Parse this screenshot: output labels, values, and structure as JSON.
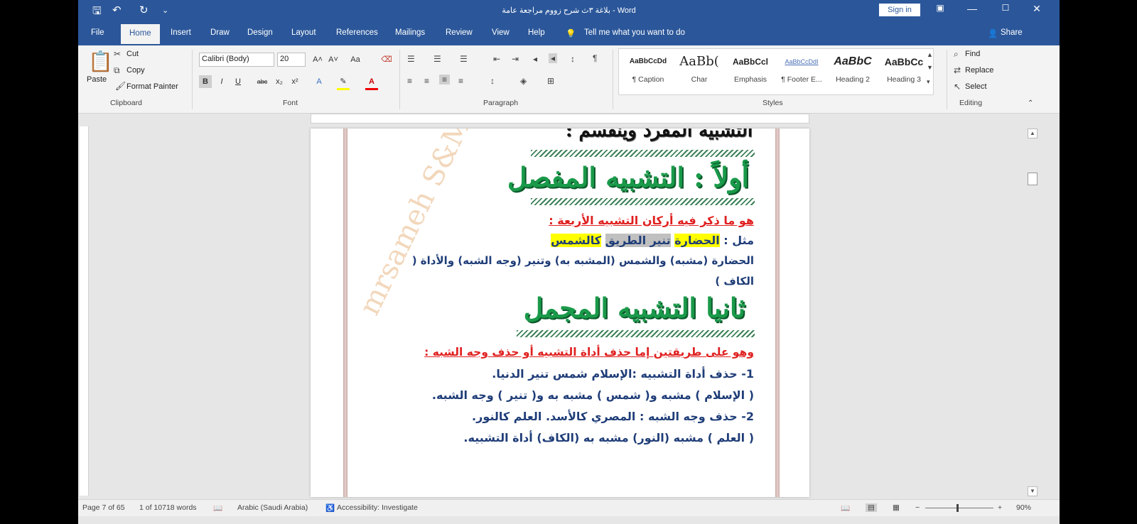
{
  "window": {
    "title": "بلاغة ٣ث شرح زووم مراجعة عامة - Word",
    "sign_in": "Sign in",
    "restore_icon": "ribbon-display-icon",
    "min_symbol": "—",
    "max_symbol": "☐",
    "close_symbol": "✕"
  },
  "quick_access": {
    "save": "🖫",
    "undo": "↶",
    "redo": "↻",
    "more": "⌄"
  },
  "tabs": [
    {
      "label": "File"
    },
    {
      "label": "Home"
    },
    {
      "label": "Insert"
    },
    {
      "label": "Draw"
    },
    {
      "label": "Design"
    },
    {
      "label": "Layout"
    },
    {
      "label": "References"
    },
    {
      "label": "Mailings"
    },
    {
      "label": "Review"
    },
    {
      "label": "View"
    },
    {
      "label": "Help"
    }
  ],
  "tell_me": "Tell me what you want to do",
  "share": "Share",
  "clipboard": {
    "paste": "Paste",
    "cut": "Cut",
    "copy": "Copy",
    "format_painter": "Format Painter",
    "label": "Clipboard"
  },
  "font": {
    "family": "Calibri (Body)",
    "size": "20",
    "grow": "A˄",
    "shrink": "A˅",
    "case": "Aa",
    "bold": "B",
    "italic": "I",
    "underline": "U",
    "strike": "abc",
    "sub": "x₂",
    "sup": "x²",
    "label": "Font"
  },
  "paragraph": {
    "label": "Paragraph",
    "pilcrow": "¶"
  },
  "styles": {
    "label": "Styles",
    "items": [
      {
        "preview": "AaBbCcDd",
        "name": "¶ Caption"
      },
      {
        "preview": "AaBb(",
        "name": "Char"
      },
      {
        "preview": "AaBbCcl",
        "name": "Emphasis"
      },
      {
        "preview": "AaBbCcDdI",
        "name": "¶ Footer E..."
      },
      {
        "preview": "AaBbC",
        "name": "Heading 2"
      },
      {
        "preview": "AaBbCc",
        "name": "Heading 3"
      }
    ]
  },
  "editing": {
    "find": "Find",
    "replace": "Replace",
    "select": "Select",
    "label": "Editing"
  },
  "document": {
    "top_heading": "التشبيه المفرد وينقسم :",
    "heading1": "أولاً : التشبيه المفصل",
    "line1": "هو ما ذكر فيه أركان التشبيه الأربعة :",
    "example_prefix": "مثل : ",
    "example_a": "الحضارة",
    "example_b": "تنير الطريق",
    "example_c": "كالشمس",
    "line3": "الحضارة (مشبه) والشمس (المشبه به) وتنير (وجه الشبه) والأداة (",
    "line4": "الكاف )",
    "heading2": "ثانيا التشبيه المجمل",
    "line5": "وهو على طريقتين إما حذف أداة التشبيه أو حذف وجه الشبه :",
    "line6": "1- حذف أداة التشبيه :الإسلام شمس تنير الدنيا.",
    "line7": "( الإسلام ) مشبه و( شمس ) مشبه به و( تنير ) وجه الشبه.",
    "line8": "2- حذف وجه الشبه : المصري كالأسد.    العلم كالنور.",
    "line9": "( العلم ) مشبه  (النور) مشبه به  (الكاف) أداة التشبيه.",
    "watermark": "mrsameh S&M&A"
  },
  "status": {
    "page": "Page 7 of 65",
    "words": "1 of 10718 words",
    "language": "Arabic (Saudi Arabia)",
    "accessibility": "Accessibility: Investigate",
    "zoom": "90%"
  }
}
